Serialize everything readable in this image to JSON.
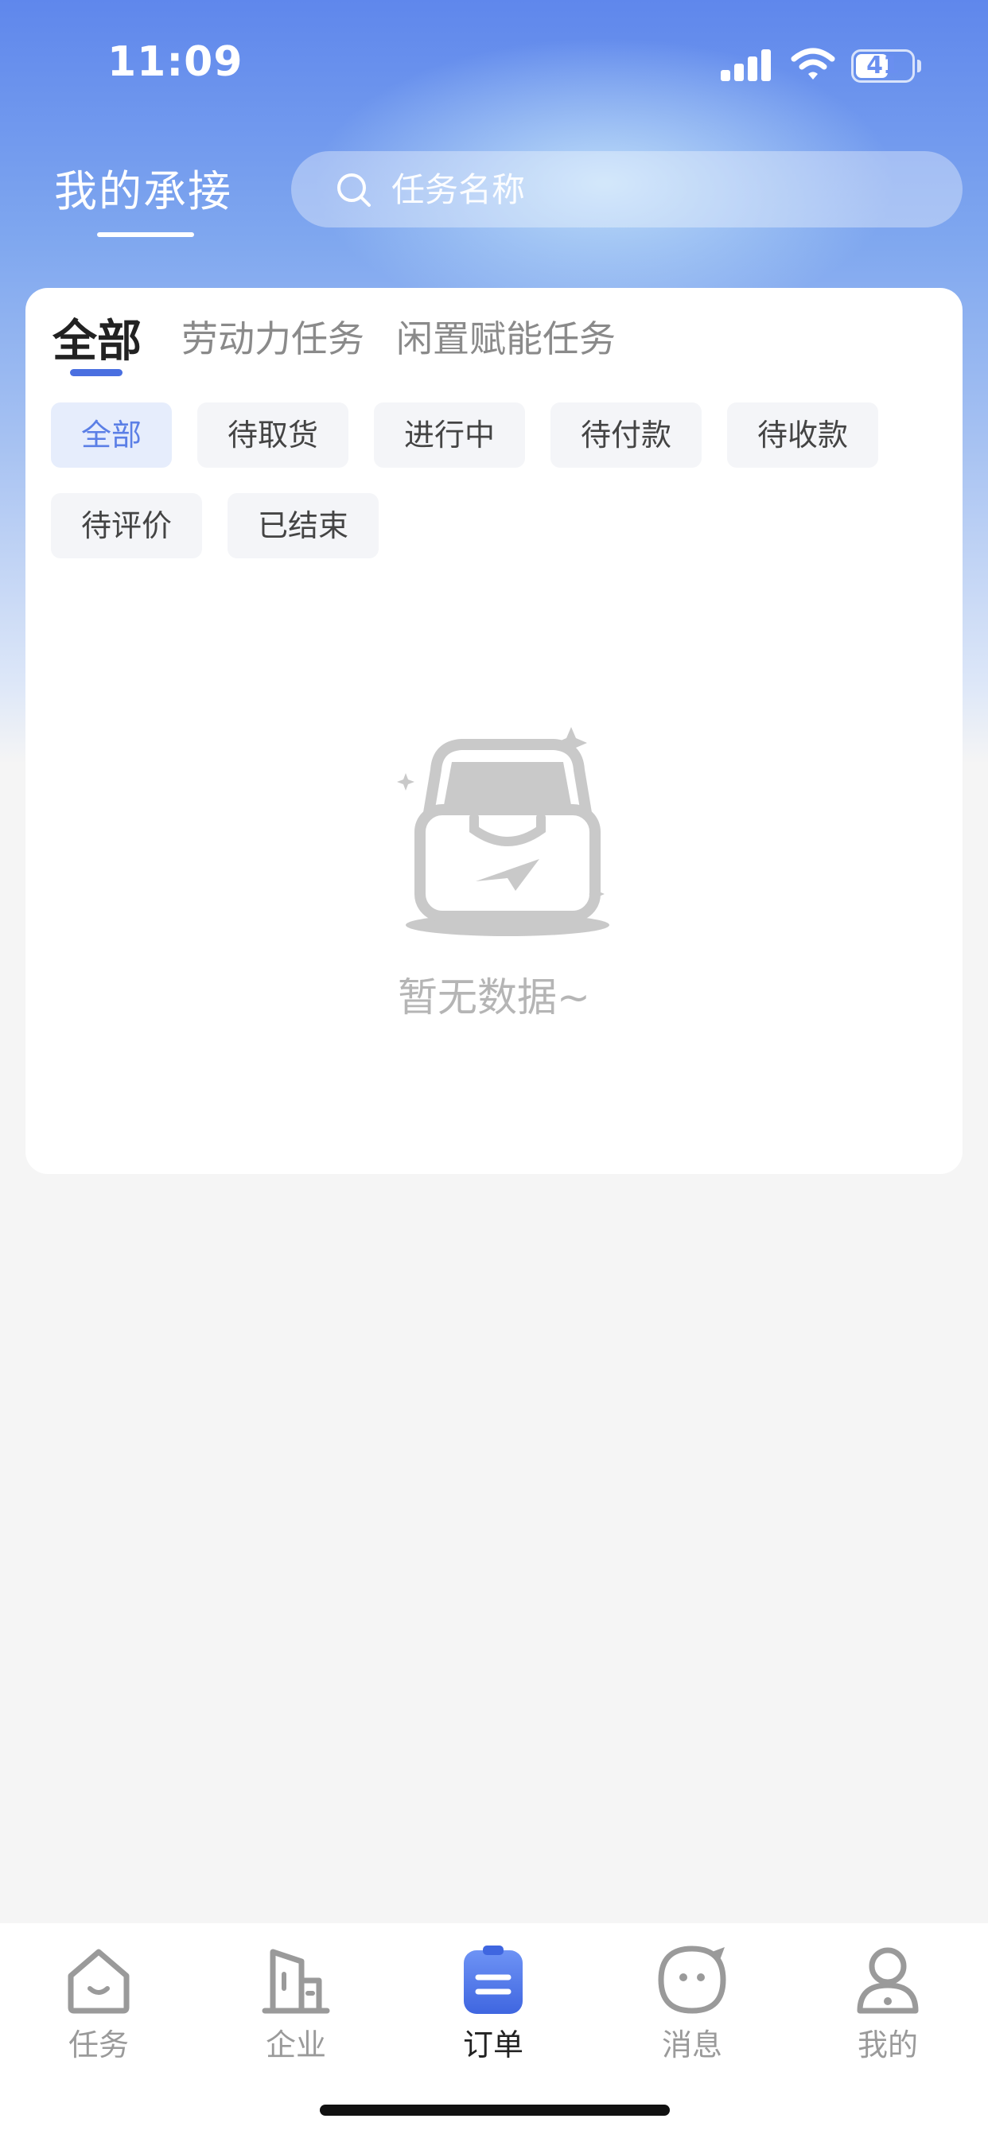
{
  "status_bar": {
    "time": "11:09",
    "battery": "41"
  },
  "header": {
    "title": "我的承接",
    "search_placeholder": "任务名称"
  },
  "category_tabs": [
    {
      "label": "全部",
      "active": true
    },
    {
      "label": "劳动力任务",
      "active": false
    },
    {
      "label": "闲置赋能任务",
      "active": false
    }
  ],
  "filter_chips": [
    {
      "label": "全部",
      "active": true
    },
    {
      "label": "待取货",
      "active": false
    },
    {
      "label": "进行中",
      "active": false
    },
    {
      "label": "待付款",
      "active": false
    },
    {
      "label": "待收款",
      "active": false
    },
    {
      "label": "待评价",
      "active": false
    },
    {
      "label": "已结束",
      "active": false
    }
  ],
  "empty_state": {
    "text": "暂无数据~",
    "icon": "empty-inbox-icon"
  },
  "tab_bar": [
    {
      "label": "任务",
      "icon": "home-smile-icon",
      "active": false
    },
    {
      "label": "企业",
      "icon": "building-icon",
      "active": false
    },
    {
      "label": "订单",
      "icon": "clipboard-icon",
      "active": true
    },
    {
      "label": "消息",
      "icon": "chat-bubble-icon",
      "active": false
    },
    {
      "label": "我的",
      "icon": "person-icon",
      "active": false
    }
  ],
  "colors": {
    "accent": "#4a6fe0",
    "header_gradient_top": "#5f87ec",
    "chip_active_bg": "#e6edfc",
    "chip_active_text": "#5b7fe6",
    "background": "#f5f5f5"
  }
}
